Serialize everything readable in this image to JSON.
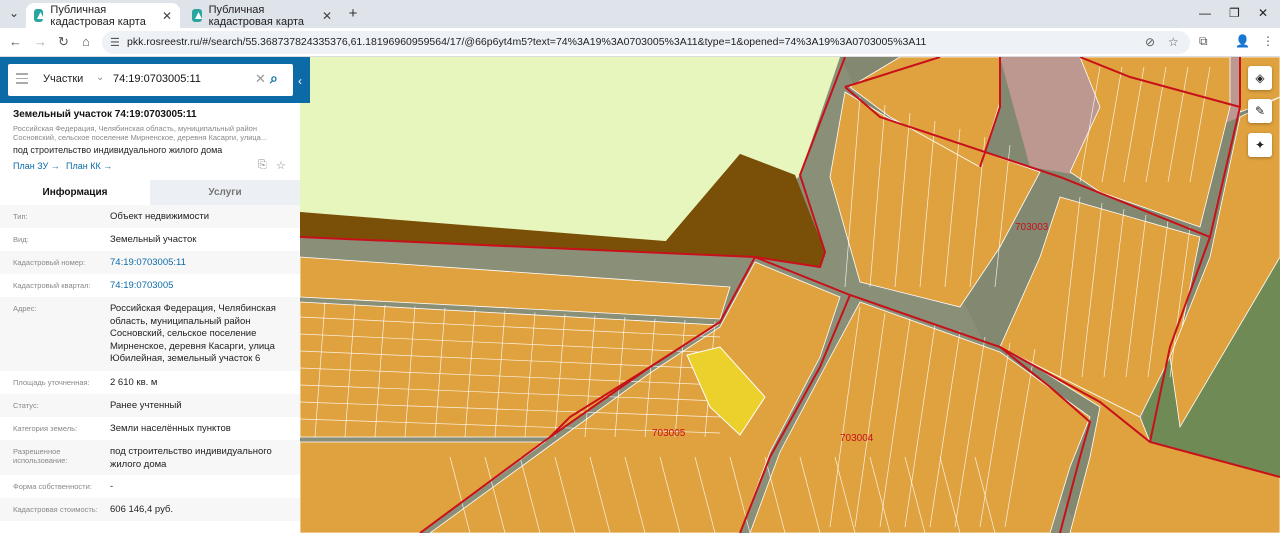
{
  "browser": {
    "tabs": [
      {
        "title": "Публичная кадастровая карта",
        "close": "✕"
      },
      {
        "title": "Публичная кадастровая карта",
        "close": "✕"
      }
    ],
    "new_tab": "+",
    "url": "pkk.rosreestr.ru/#/search/55.36873782433537​6,61.18196960959564/17/@66p6yt4m5?text=74%3A19%3A0703005%3A11&type=1&opened=74%3A19%3A0703005%3A11"
  },
  "search": {
    "type_label": "Участки",
    "query": "74:19:0703005:11"
  },
  "object": {
    "title": "Земельный участок 74:19:0703005:11",
    "address_short": "Российская Федерация, Челябинская область, муниципальный район Сосновский, сельское поселение Мирненское, деревня Касарги, улица...",
    "purpose": "под строительство индивидуального жилого дома",
    "plan_zu": "План ЗУ →",
    "plan_kk": "План КК →"
  },
  "panel_tabs": {
    "info": "Информация",
    "services": "Услуги"
  },
  "rows": [
    {
      "key": "Тип:",
      "value": "Объект недвижимости"
    },
    {
      "key": "Вид:",
      "value": "Земельный участок"
    },
    {
      "key": "Кадастровый номер:",
      "value": "74:19:0703005:11"
    },
    {
      "key": "Кадастровый квартал:",
      "value": "74:19:0703005"
    },
    {
      "key": "Адрес:",
      "value": "Российская Федерация, Челябинская область, муниципальный район Сосновский, сельское поселение Мирненское, деревня Касарги, улица Юбилейная, земельный участок 6"
    },
    {
      "key": "Площадь уточненная:",
      "value": "2 610 кв. м"
    },
    {
      "key": "Статус:",
      "value": "Ранее учтенный"
    },
    {
      "key": "Категория земель:",
      "value": "Земли населённых пунктов"
    },
    {
      "key": "Разрешенное использование:",
      "value": "под строительство индивидуального жилого дома"
    },
    {
      "key": "Форма собственности:",
      "value": "-"
    },
    {
      "key": "Кадастровая стоимость:",
      "value": "606 146,4 руб."
    }
  ],
  "map": {
    "quarter_labels": [
      "703003",
      "703005",
      "703004"
    ],
    "colors": {
      "parcel": "#e0a23e",
      "parcel_border": "#ffffff",
      "quarter_border": "#c8101a",
      "highlight": "#ecd12c",
      "brown_zone": "#7a4f07",
      "green_zone": "#e7f6bd",
      "pink_zone": "#c79b95"
    }
  }
}
